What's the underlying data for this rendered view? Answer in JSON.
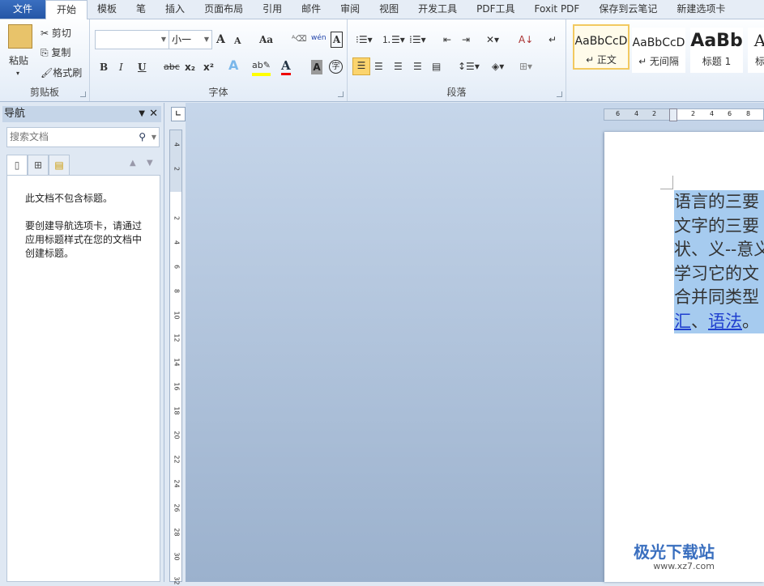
{
  "tabs": [
    "文件",
    "开始",
    "模板",
    "笔",
    "插入",
    "页面布局",
    "引用",
    "邮件",
    "审阅",
    "视图",
    "开发工具",
    "PDF工具",
    "Foxit PDF",
    "保存到云笔记",
    "新建选项卡"
  ],
  "clipboard": {
    "paste": "粘贴",
    "cut": "剪切",
    "copy": "复制",
    "format_painter": "格式刷",
    "label": "剪贴板"
  },
  "font": {
    "name": "",
    "size": "小一",
    "label": "字体",
    "bold": "B",
    "italic": "I",
    "underline": "U",
    "strike": "abc",
    "sub": "x₂",
    "sup": "x²",
    "grow": "A",
    "shrink": "A",
    "case": "Aa",
    "pinyin": "wén",
    "border": "A",
    "color": "A",
    "shade": "A",
    "enclose": "字"
  },
  "paragraph": {
    "label": "段落"
  },
  "styles": [
    {
      "sample": "AaBbCcD",
      "name": "↵ 正文"
    },
    {
      "sample": "AaBbCcD",
      "name": "↵ 无间隔"
    },
    {
      "sample": "AaBb",
      "name": "标题 1"
    },
    {
      "sample": "A",
      "name": "标"
    }
  ],
  "nav": {
    "title": "导航",
    "search_placeholder": "搜索文档",
    "msg1": "此文档不包含标题。",
    "msg2": "要创建导航选项卡，请通过应用标题样式在您的文档中创建标题。"
  },
  "vruler": [
    "4",
    "2",
    "2",
    "4",
    "6",
    "8",
    "10",
    "12",
    "14",
    "16",
    "18",
    "20",
    "22",
    "24",
    "26",
    "28",
    "30",
    "32"
  ],
  "hruler": [
    "6",
    "4",
    "2",
    "2",
    "4",
    "6",
    "8"
  ],
  "doc": {
    "lines": [
      "语言的三要",
      "文字的三要",
      "状、义--意义",
      "学习它的文",
      "合并同类型"
    ],
    "last_a": "汇",
    "sep": "、",
    "last_b": "语法",
    "end": "。"
  },
  "watermark": {
    "name": "极光下载站",
    "url": "www.xz7.com"
  }
}
